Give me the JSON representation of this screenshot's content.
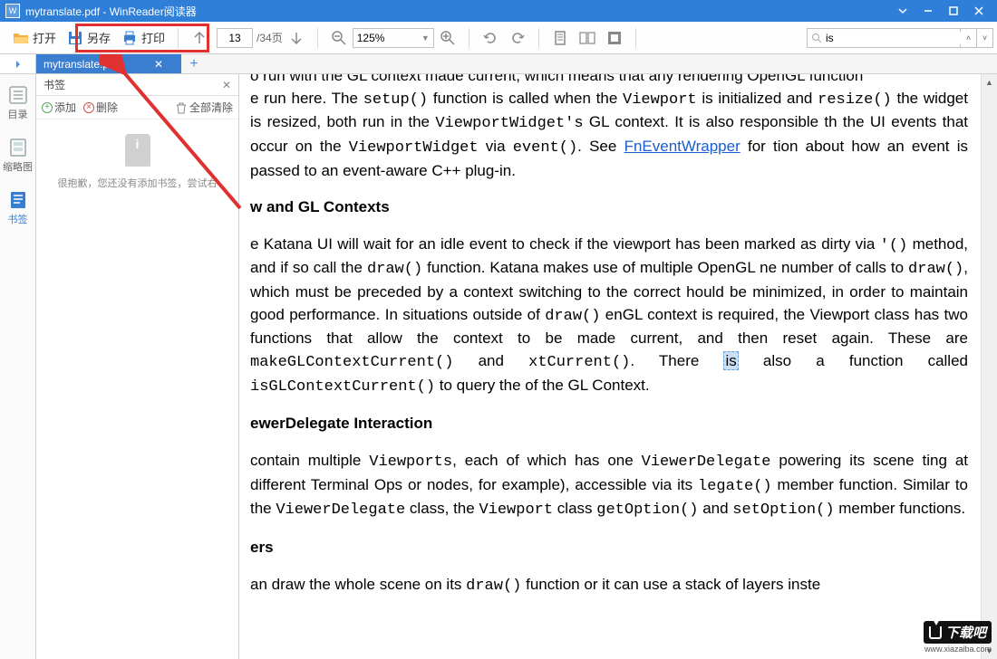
{
  "window": {
    "title": "mytranslate.pdf - WinReader阅读器"
  },
  "toolbar": {
    "open": "打开",
    "save": "另存",
    "print": "打印",
    "page_current": "13",
    "page_total": "/34页",
    "zoom": "125%",
    "search_value": "is"
  },
  "tab": {
    "name": "mytranslate.pdf"
  },
  "rail": {
    "toc": "目录",
    "thumb": "缩略图",
    "bookmark": "书签"
  },
  "panel": {
    "title": "书签",
    "add": "添加",
    "delete": "删除",
    "clear": "全部清除",
    "empty": "很抱歉，您还没有添加书签，尝试右"
  },
  "doc": {
    "p1a": "o run with the GL context made current, which means that any rendering OpenGL function",
    "p1b": "e run here. The ",
    "p1c": " function is called when the ",
    "p1d": " is initialized and ",
    "p1e": " the widget is resized, both run in the ",
    "p1f": " GL context. It is also responsible th the UI events that occur on the ",
    "p1g": " via ",
    "p1h": ". See ",
    "p1i": " for tion about how an event is passed to an event-aware C++ plug-in.",
    "link1": "FnEventWrapper",
    "h1": "w and GL Contexts",
    "p2a": "e Katana UI will wait for an idle event to check if the viewport has been marked as dirty via ",
    "p2b": " method, and if so call the ",
    "p2c": " function. Katana makes use of multiple OpenGL ne number of calls to ",
    "p2d": ", which must be preceded by a context switching to the correct hould be minimized, in order to maintain good performance. In situations outside of ",
    "p2e": " enGL context is required, the Viewport class has two functions that allow the context to be made current, and then reset again. These are ",
    "p2f": " and ",
    "p2g": ". There ",
    "p2h": " also a function called ",
    "p2i": " to query the of the GL Context.",
    "hiword": "is",
    "h2": "ewerDelegate Interaction",
    "p3a": " contain multiple ",
    "p3b": ", each of which has one ",
    "p3c": " powering its scene ting at different Terminal Ops or nodes, for example), accessible via its ",
    "p3d": " member function. Similar to the ",
    "p3e": " class, the ",
    "p3f": " class ",
    "p3g": " and ",
    "p3h": " member functions.",
    "h3": "ers",
    "p4a": "an draw the whole scene on its ",
    "p4b": " function or it can use a stack of layers inste",
    "code": {
      "setup": "setup()",
      "viewport": "Viewport",
      "resize": "resize()",
      "vw": "ViewportWidget's",
      "vw2": "ViewportWidget",
      "event": "event()",
      "dirty": "'()",
      "draw": "draw()",
      "mk": "makeGLContextCurrent()",
      "xt": "xtCurrent()",
      "isgl": "isGLContextCurrent()",
      "vps": "Viewports",
      "vd": "ViewerDelegate",
      "leg": "legate()",
      "vd2": "ViewerDelegate",
      "vp2": "Viewport",
      "geto": "getOption()",
      "seto": "setOption()"
    }
  },
  "watermark": {
    "text": "下载吧",
    "url": "www.xiazaiba.com"
  }
}
